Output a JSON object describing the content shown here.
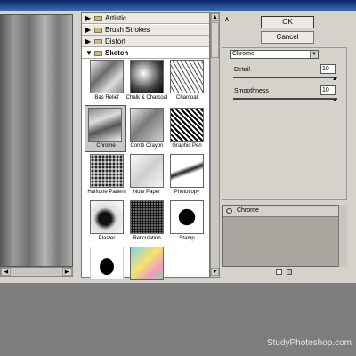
{
  "buttons": {
    "ok": "OK",
    "cancel": "Cancel"
  },
  "gallery": {
    "categories_collapsed": [
      "Artistic",
      "Brush Strokes",
      "Distort"
    ],
    "open_category": "Sketch",
    "filters": [
      {
        "name": "Bas Relief",
        "selected": false
      },
      {
        "name": "Chalk & Charcoal",
        "selected": false
      },
      {
        "name": "Charcoal",
        "selected": false
      },
      {
        "name": "Chrome",
        "selected": true
      },
      {
        "name": "Conté Crayon",
        "selected": false
      },
      {
        "name": "Graphic Pen",
        "selected": false
      },
      {
        "name": "Halftone Pattern",
        "selected": false
      },
      {
        "name": "Note Paper",
        "selected": false
      },
      {
        "name": "Photocopy",
        "selected": false
      },
      {
        "name": "Plaster",
        "selected": false
      },
      {
        "name": "Reticulation",
        "selected": false
      },
      {
        "name": "Stamp",
        "selected": false
      },
      {
        "name": "",
        "selected": false
      },
      {
        "name": "",
        "selected": false
      }
    ]
  },
  "settings": {
    "filter_select": "Chrome",
    "detail": {
      "label": "Detail",
      "value": "10"
    },
    "smoothness": {
      "label": "Smoothness",
      "value": "10"
    }
  },
  "layers": {
    "active": "Chrome"
  },
  "watermark": "StudyPhotoshop.com"
}
